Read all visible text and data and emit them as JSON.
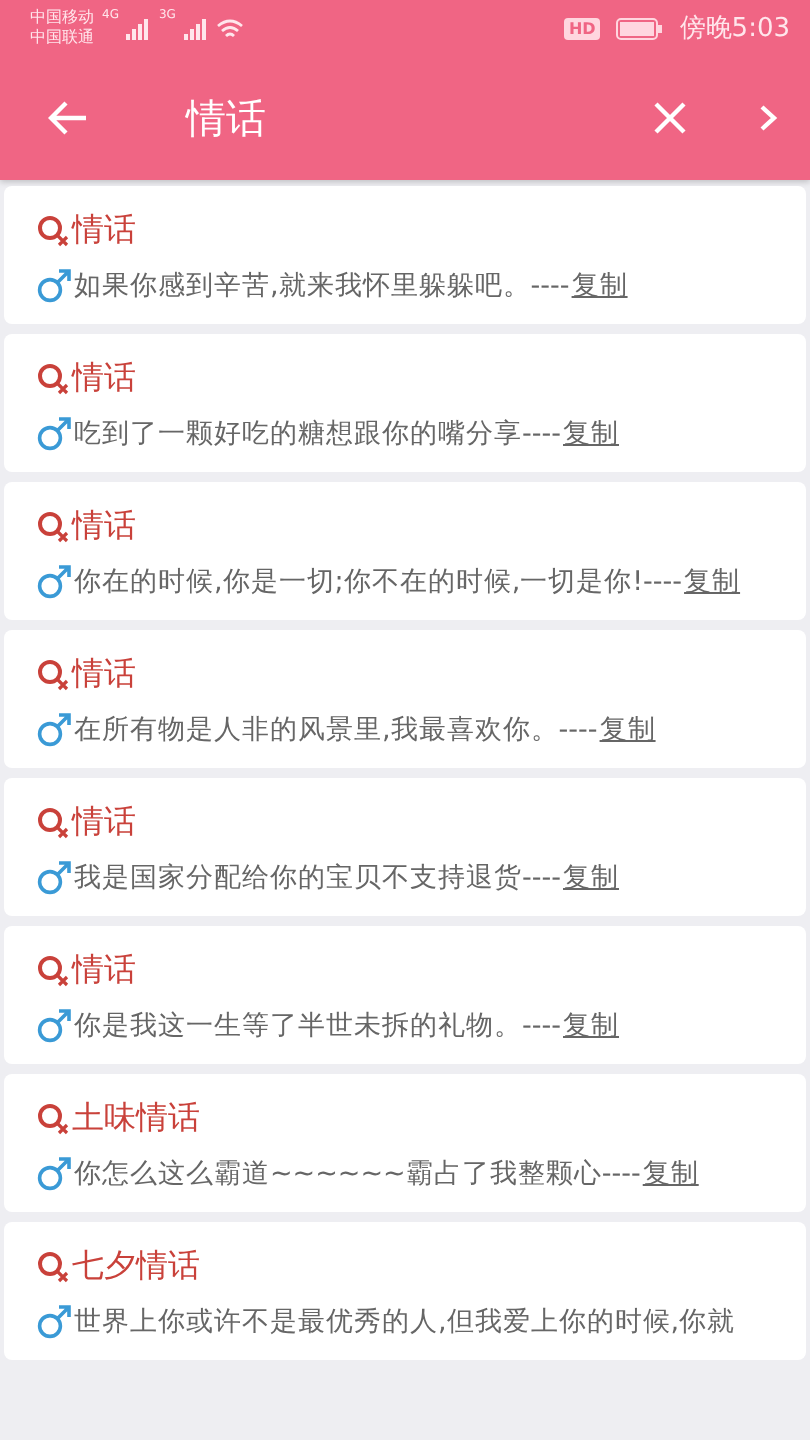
{
  "status_bar": {
    "carriers": [
      "中国移动",
      "中国联通"
    ],
    "network_labels": [
      "4G",
      "3G"
    ],
    "hd": "HD",
    "time": "傍晚5:03"
  },
  "toolbar": {
    "title": "情话"
  },
  "items": [
    {
      "category": "情话",
      "text": "如果你感到辛苦,就来我怀里躲躲吧。----",
      "link": "复制"
    },
    {
      "category": "情话",
      "text": "吃到了一颗好吃的糖想跟你的嘴分享----",
      "link": "复制"
    },
    {
      "category": "情话",
      "text": "你在的时候,你是一切;你不在的时候,一切是你!----",
      "link": "复制"
    },
    {
      "category": "情话",
      "text": "在所有物是人非的风景里,我最喜欢你。----",
      "link": "复制"
    },
    {
      "category": "情话",
      "text": "我是国家分配给你的宝贝不支持退货----",
      "link": "复制"
    },
    {
      "category": "情话",
      "text": "你是我这一生等了半世未拆的礼物。----",
      "link": "复制"
    },
    {
      "category": "土味情话",
      "text": "你怎么这么霸道~~~~~~霸占了我整颗心----",
      "link": "复制"
    },
    {
      "category": "七夕情话",
      "text": "世界上你或许不是最优秀的人,但我爱上你的时候,你就"
    }
  ]
}
